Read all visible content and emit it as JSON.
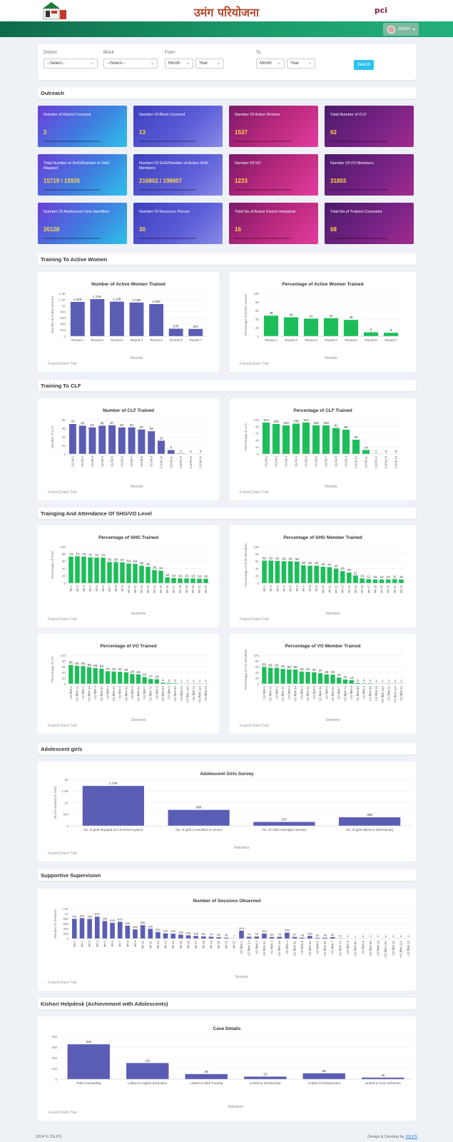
{
  "header": {
    "title": "उमंग परियोजना",
    "partner_logo": "pci",
    "user": "Admin"
  },
  "filters": {
    "district": {
      "label": "District",
      "value": "--Select--"
    },
    "block": {
      "label": "Block",
      "value": "--Select--"
    },
    "from": {
      "label": "From",
      "month": "Month",
      "year": "Year"
    },
    "to": {
      "label": "To",
      "month": "Month",
      "year": "Year"
    },
    "search": "Search"
  },
  "sections": {
    "outreach": "Outreach",
    "training_active_women": "Training To Active Women",
    "training_clf": "Training To CLF",
    "training_shg_vo": "Trainging And Attendance Of SHG/VO Level",
    "adolescent": "Adolescent girls",
    "supportive": "Supportive Supervision",
    "kishori": "Kishori Helpdesk (Achievement with Adolescents)"
  },
  "stats": [
    {
      "label": "Number of District Covered",
      "value": "2",
      "theme": "cyan"
    },
    {
      "label": "Number Of Block Covered",
      "value": "13",
      "theme": "blue"
    },
    {
      "label": "Number Of Active Women",
      "value": "1537",
      "theme": "mag"
    },
    {
      "label": "Total Number of CLF",
      "value": "62",
      "theme": "purp"
    },
    {
      "label": "Total Number of SHG/Number of SHG Mapped",
      "value": "15719 / 15935",
      "theme": "cyan"
    },
    {
      "label": "Number Of SHG/Number of Active SHG Members",
      "value": "216802 / 198607",
      "theme": "blue"
    },
    {
      "label": "Number Of VO",
      "value": "1233",
      "theme": "mag"
    },
    {
      "label": "Number Of VO Members",
      "value": "31803",
      "theme": "purp"
    },
    {
      "label": "Number Of Adolescent Girls identified",
      "value": "26128",
      "theme": "cyan"
    },
    {
      "label": "Number Of Resource Person",
      "value": "30",
      "theme": "blue"
    },
    {
      "label": "Total No.of Active Kishori Helpdesk",
      "value": "16",
      "theme": "mag"
    },
    {
      "label": "Total No.of Trained Counselor",
      "value": "68",
      "theme": "purp"
    }
  ],
  "trial_label": "FusionCharts Trial",
  "footer": {
    "left": "2024 © JSLPS",
    "right_prefix": "Design & Develop by",
    "right_link": "JSLPS"
  },
  "chart_data": [
    {
      "id": "aw-count",
      "type": "bar",
      "title": "Number of Active Women Trained",
      "xlabel": "Rounds",
      "ylabel": "Number of Active Women",
      "color": "#5b5db4",
      "ylim": [
        0,
        1400
      ],
      "yticks": [
        "0",
        "200",
        "400",
        "600",
        "800",
        "1K",
        "1.2K",
        "1.4K"
      ],
      "categories": [
        "Round 1",
        "Round 2",
        "Round 3",
        "Round 4",
        "Round 5",
        "Round 6",
        "Round 7"
      ],
      "values": [
        1120,
        1210,
        1130,
        1100,
        1050,
        245,
        237
      ],
      "labels": [
        "1.12K",
        "1.21K",
        "1.13K",
        "1.10K",
        "1.05K",
        "245",
        "237"
      ]
    },
    {
      "id": "aw-pct",
      "type": "bar",
      "title": "Percentage of Active Women Trained",
      "xlabel": "Rounds",
      "ylabel": "Percentage of Active Women",
      "color": "#1dbe5a",
      "ylim": [
        0,
        100
      ],
      "yticks": [
        "0",
        "20",
        "40",
        "60",
        "80",
        "100"
      ],
      "categories": [
        "Round 1",
        "Round 2",
        "Round 3",
        "Round 4",
        "Round 5",
        "Round 6",
        "Round 7"
      ],
      "values": [
        48,
        44,
        41,
        42,
        38,
        9,
        8
      ],
      "labels": [
        "48",
        "44",
        "41",
        "42",
        "38",
        "9",
        "8"
      ]
    },
    {
      "id": "clf-count",
      "type": "bar",
      "title": "Number of CLF Trained",
      "xlabel": "Rounds",
      "ylabel": "Number of CLF",
      "color": "#5b5db4",
      "ylim": [
        0,
        80
      ],
      "yticks": [
        "0",
        "20",
        "40",
        "60",
        "80"
      ],
      "categories": [
        "CLFM-1",
        "CLFM-2",
        "CLFM-3",
        "CLFM-4",
        "CLFM-5",
        "CLFM-6",
        "CLFM-7",
        "CLFM-8",
        "CLFM-9",
        "CLFM-10",
        "CLFM-11",
        "CLFM-12",
        "CLFM-13",
        "CLFM-14"
      ],
      "values": [
        70,
        66,
        62,
        66,
        67,
        62,
        62,
        57,
        53,
        31,
        9,
        1,
        0,
        0
      ],
      "labels": [
        "70",
        "66",
        "62",
        "66",
        "67",
        "62",
        "62",
        "57",
        "53",
        "31",
        "9",
        "1",
        "0",
        "0"
      ]
    },
    {
      "id": "clf-pct",
      "type": "bar",
      "title": "Percentage of CLF Trained",
      "xlabel": "Rounds",
      "ylabel": "Percentage of CLF",
      "color": "#1dbe5a",
      "ylim": [
        0,
        120
      ],
      "yticks": [
        "0",
        "24",
        "48",
        "72",
        "96",
        "120"
      ],
      "categories": [
        "CLFM-1",
        "CLFM-2",
        "CLFM-3",
        "CLFM-4",
        "CLFM-5",
        "CLFM-6",
        "CLFM-7",
        "CLFM-8",
        "CLFM-9",
        "CLFM-10",
        "CLFM-11",
        "CLFM-12",
        "CLFM-13",
        "CLFM-14"
      ],
      "values": [
        110,
        105,
        100,
        106,
        110,
        100,
        100,
        91,
        85,
        50,
        14,
        1,
        0,
        0
      ],
      "labels": [
        "110",
        "105",
        "100",
        "106",
        "110",
        "100",
        "100",
        "91",
        "85",
        "50",
        "14",
        "1",
        "0",
        "0"
      ]
    },
    {
      "id": "shg-pct",
      "type": "bar",
      "title": "Percentage of SHG Trained",
      "xlabel": "Sessions",
      "ylabel": "Percentage of SHG",
      "color": "#1dbe5a",
      "ylim": [
        0,
        100
      ],
      "yticks": [
        "0",
        "20",
        "40",
        "60",
        "80",
        "100"
      ],
      "categories": [
        "सत्र 1",
        "सत्र 2",
        "सत्र 3",
        "सत्र 4",
        "सत्र 5",
        "सत्र 6",
        "सत्र 7",
        "सत्र 8",
        "सत्र 9",
        "सत्र 10",
        "सत्र 11",
        "सत्र 12",
        "सत्र 13",
        "सत्र 14",
        "सत्र 15",
        "सत्र 16",
        "सत्र 17",
        "सत्र 18",
        "सत्र 19",
        "सत्र 20",
        "सत्र 21",
        "सत्र 22"
      ],
      "values": [
        73,
        74,
        73,
        71,
        70,
        70,
        58,
        58,
        57,
        54,
        53,
        48,
        45,
        36,
        34,
        16,
        14,
        13,
        13,
        13,
        12,
        12
      ],
      "labels": [
        "73",
        "74",
        "73",
        "71",
        "70",
        "70",
        "58",
        "58",
        "57",
        "54",
        "53",
        "48",
        "45",
        "36",
        "34",
        "16",
        "14",
        "13",
        "13",
        "13",
        "12",
        "12"
      ]
    },
    {
      "id": "shg-mem-pct",
      "type": "bar",
      "title": "Percentage of SHG Member Trained",
      "xlabel": "Sessions",
      "ylabel": "Percentage of SHG Members",
      "color": "#1dbe5a",
      "ylim": [
        0,
        100
      ],
      "yticks": [
        "0",
        "20",
        "40",
        "60",
        "80",
        "100"
      ],
      "categories": [
        "सत्र 1",
        "सत्र 2",
        "सत्र 3",
        "सत्र 4",
        "सत्र 5",
        "सत्र 6",
        "सत्र 7",
        "सत्र 8",
        "सत्र 9",
        "सत्र 10",
        "सत्र 11",
        "सत्र 12",
        "सत्र 13",
        "सत्र 14",
        "सत्र 15",
        "सत्र 16",
        "सत्र 17",
        "सत्र 18",
        "सत्र 19",
        "सत्र 20",
        "सत्र 21",
        "सत्र 22"
      ],
      "values": [
        62,
        62,
        61,
        60,
        60,
        59,
        49,
        48,
        48,
        45,
        44,
        40,
        33,
        29,
        21,
        13,
        11,
        10,
        10,
        10,
        11,
        10
      ],
      "labels": [
        "62",
        "62",
        "61",
        "60",
        "60",
        "59",
        "49",
        "48",
        "48",
        "45",
        "44",
        "40",
        "33",
        "29",
        "21",
        "13",
        "11",
        "10",
        "10",
        "10",
        "11",
        "10"
      ]
    },
    {
      "id": "vo-pct",
      "type": "bar",
      "title": "Percentage of VO Trained",
      "xlabel": "Sessions",
      "ylabel": "Percentage of VO",
      "color": "#1dbe5a",
      "ylim": [
        0,
        100
      ],
      "yticks": [
        "0",
        "20",
        "40",
        "60",
        "80",
        "100"
      ],
      "categories": [
        "VO बैठक 1",
        "VO बैठक 1A",
        "VO बैठक 2",
        "VO बैठक 2A",
        "VO बैठक 3",
        "VO बैठक 3A",
        "VO बैठक 4",
        "VO बैठक 4A",
        "VO बैठक 5",
        "VO बैठक 5A",
        "VO बैठक 6",
        "VO बैठक 6A",
        "VO बैठक 7",
        "VO बैठक 7A",
        "VO बैठक 8",
        "VO बैठक 8A",
        "VO बैठक 9",
        "VO बैठक 9A",
        "VO बैठक 10",
        "VO बैठक 10A",
        "VO बैठक 11",
        "VO बैठक 11A",
        "VO बैठक 12"
      ],
      "values": [
        66,
        63,
        62,
        58,
        55,
        53,
        44,
        43,
        42,
        40,
        34,
        33,
        24,
        17,
        16,
        4,
        3,
        2,
        1,
        1,
        1,
        1,
        1
      ],
      "labels": [
        "66",
        "63",
        "62",
        "58",
        "55",
        "53",
        "44",
        "43",
        "42",
        "40",
        "34",
        "33",
        "24",
        "17",
        "16",
        "4",
        "3",
        "2",
        "1",
        "1",
        "1",
        "1",
        "1"
      ]
    },
    {
      "id": "vo-mem-pct",
      "type": "bar",
      "title": "Percentage of VO Member Trained",
      "xlabel": "Sessions",
      "ylabel": "Percentage of VO Members",
      "color": "#1dbe5a",
      "ylim": [
        0,
        100
      ],
      "yticks": [
        "0",
        "20",
        "40",
        "60",
        "80",
        "100"
      ],
      "categories": [
        "VO बैठक 1",
        "VO बैठक 1A",
        "VO बैठक 2",
        "VO बैठक 2A",
        "VO बैठक 3",
        "VO बैठक 3A",
        "VO बैठक 4",
        "VO बैठक 4A",
        "VO बैठक 5",
        "VO बैठक 5A",
        "VO बैठक 6",
        "VO बैठक 6A",
        "VO बैठक 7",
        "VO बैठक 7A",
        "VO बैठक 8",
        "VO बैठक 8A",
        "VO बैठक 9",
        "VO बैठक 9A",
        "VO बैठक 10",
        "VO बैठक 10A",
        "VO बैठक 11",
        "VO बैठक 11A",
        "VO बैठक 12"
      ],
      "values": [
        59,
        56,
        56,
        52,
        50,
        50,
        43,
        42,
        40,
        37,
        33,
        32,
        22,
        15,
        13,
        3,
        2,
        2,
        1,
        1,
        1,
        1,
        1
      ],
      "labels": [
        "59",
        "56",
        "56",
        "52",
        "50",
        "50",
        "43",
        "42",
        "40",
        "37",
        "33",
        "32",
        "22",
        "15",
        "13",
        "3",
        "2",
        "2",
        "1",
        "1",
        "1",
        "1",
        "1"
      ]
    },
    {
      "id": "adolescent",
      "type": "bar",
      "title": "Adolescent Girls Survey",
      "xlabel": "Indicators",
      "ylabel": "No.of Adolescent Girls",
      "color": "#5b5db4",
      "ylim": [
        0,
        2000
      ],
      "yticks": [
        "0",
        "500",
        "1K",
        "1.5K",
        "2K"
      ],
      "categories": [
        "No. of girls dropped out of school system",
        "No. of girls re-enrolled in school",
        "No. of child marriages averted",
        "No. of girls linked to skill training"
      ],
      "values": [
        1720,
        686,
        167,
        368
      ],
      "labels": [
        "1.72K",
        "686",
        "167",
        "368"
      ]
    },
    {
      "id": "sessions",
      "type": "bar",
      "title": "Number of Sessions Observed",
      "xlabel": "Session",
      "ylabel": "Number of Sessions",
      "color": "#5b5db4",
      "ylim": [
        0,
        1200
      ],
      "yticks": [
        "0",
        "200",
        "400",
        "600",
        "800",
        "1K",
        "1.2K"
      ],
      "categories": [
        "सत्र 1",
        "सत्र 2",
        "सत्र 3",
        "सत्र 4",
        "सत्र 5",
        "सत्र 6",
        "सत्र 7",
        "सत्र 8",
        "सत्र 9",
        "सत्र 10",
        "सत्र 11",
        "सत्र 12",
        "सत्र 13",
        "सत्र 14",
        "सत्र 15",
        "सत्र 16",
        "सत्र 17",
        "सत्र 18",
        "सत्र 19",
        "सत्र 20",
        "सत्र 21",
        "सत्र 22",
        "VO बैठक 1",
        "VO बैठक 1A",
        "VO बैठक 2",
        "VO बैठक 2A",
        "VO बैठक 3",
        "VO बैठक 3A",
        "VO बैठक 4",
        "VO बैठक 4A",
        "VO बैठक 5",
        "VO बैठक 5A",
        "VO बैठक 6",
        "VO बैठक 6A",
        "VO बैठक 7",
        "VO बैठक 7A",
        "VO बैठक 8",
        "VO बैठक 8A",
        "VO बैठक 9",
        "VO बैठक 9A",
        "VO बैठक 10",
        "VO बैठक 10A",
        "VO बैठक 11",
        "VO बैठक 11A",
        "VO बैठक 12"
      ],
      "values": [
        790,
        821,
        786,
        879,
        703,
        633,
        673,
        518,
        369,
        536,
        390,
        262,
        209,
        194,
        158,
        130,
        106,
        85,
        74,
        55,
        36,
        7,
        319,
        74,
        79,
        203,
        63,
        70,
        236,
        67,
        38,
        103,
        32,
        36,
        62,
        12,
        2,
        1,
        0,
        0,
        0,
        0,
        0,
        0,
        0
      ],
      "labels": [
        "790",
        "821",
        "786",
        "879",
        "703",
        "633",
        "673",
        "518",
        "369",
        "536",
        "390",
        "262",
        "209",
        "194",
        "158",
        "130",
        "106",
        "85",
        "74",
        "55",
        "36",
        "7",
        "319",
        "74",
        "79",
        "203",
        "63",
        "70",
        "236",
        "67",
        "38",
        "103",
        "32",
        "36",
        "62",
        "12",
        "2",
        "1",
        "0",
        "0",
        "0",
        "0",
        "0",
        "0",
        "0"
      ]
    },
    {
      "id": "case",
      "type": "bar",
      "title": "Case Details",
      "xlabel": "Indicators",
      "ylabel": "",
      "color": "#5b5db4",
      "ylim": [
        0,
        400
      ],
      "yticks": [
        "0",
        "100",
        "200",
        "300",
        "400"
      ],
      "categories": [
        "Total Counselling",
        "Linked to Higher Education",
        "Linked to Skill Training",
        "Linked to Scholarship",
        "Linked to Employment",
        "Linked to Govt Schemes"
      ],
      "values": [
        326,
        151,
        48,
        24,
        55,
        15
      ],
      "labels": [
        "326",
        "151",
        "48",
        "24",
        "55",
        "15"
      ]
    }
  ]
}
